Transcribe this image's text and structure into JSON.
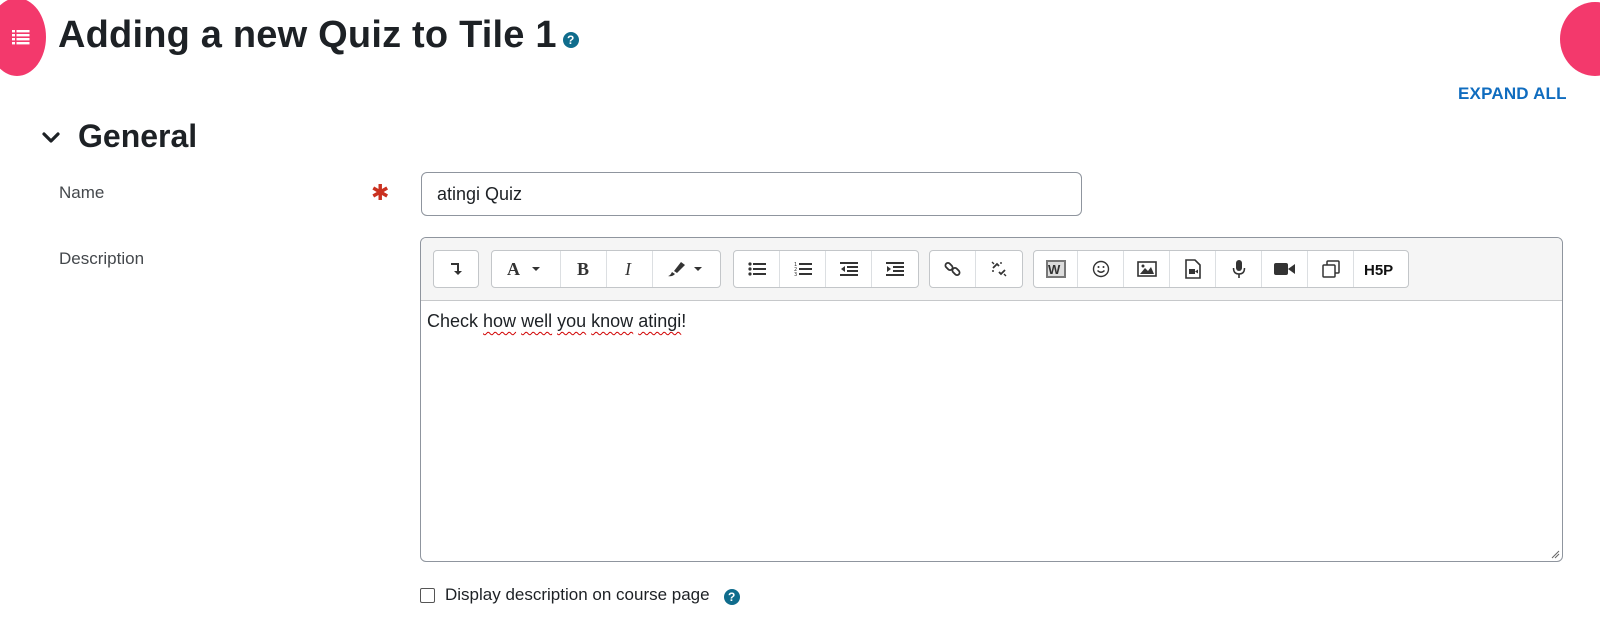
{
  "page": {
    "title_prefix": "Adding a new Quiz to Tile 1",
    "title_help_glyph": "?",
    "expand_all": "EXPAND ALL"
  },
  "section": {
    "title": "General"
  },
  "fields": {
    "name_label": "Name",
    "name_value": "atingi Quiz",
    "required_glyph": "✱",
    "description_label": "Description"
  },
  "editor": {
    "content_parts": [
      "Check ",
      "how",
      " ",
      "well",
      " ",
      "you",
      " ",
      "know",
      " ",
      "atingi",
      "!"
    ],
    "toolbar_icons": [
      "collapse-toolbar-icon",
      "font-style-icon",
      "bold-icon",
      "italic-icon",
      "font-color-icon",
      "unordered-list-icon",
      "ordered-list-icon",
      "outdent-icon",
      "indent-icon",
      "link-icon",
      "unlink-icon",
      "word-import-icon",
      "emoji-icon",
      "image-icon",
      "media-icon",
      "record-audio-icon",
      "record-video-icon",
      "manage-files-icon",
      "h5p-icon"
    ],
    "h5p_label": "H5P"
  },
  "checkbox": {
    "label": "Display description on course page",
    "checked": false,
    "help_glyph": "?"
  },
  "colors": {
    "accent_pink": "#f3396c",
    "link_blue": "#0f6cbf",
    "help_teal": "#0f6c8c",
    "required_red": "#ca3120"
  }
}
